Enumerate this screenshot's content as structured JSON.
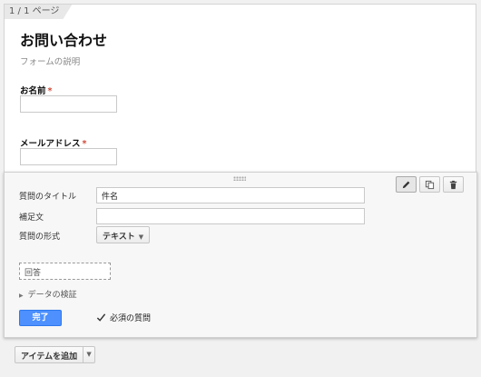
{
  "page_indicator": "1 / 1 ページ",
  "form": {
    "title": "お問い合わせ",
    "description": "フォームの説明"
  },
  "questions": [
    {
      "label": "お名前",
      "required_mark": "*"
    },
    {
      "label": "メールアドレス",
      "required_mark": "*"
    }
  ],
  "editor": {
    "title_label": "質問のタイトル",
    "title_value": "件名",
    "help_label": "補足文",
    "help_value": "",
    "type_label": "質問の形式",
    "type_value": "テキスト",
    "answer_placeholder": "回答",
    "validation_label": "データの検証",
    "done_label": "完了",
    "required_label": "必須の質問",
    "required_checked": true
  },
  "toolbar": {
    "icons": [
      "pencil-icon",
      "duplicate-icon",
      "trash-icon"
    ]
  },
  "add_item": {
    "label": "アイテムを追加"
  }
}
